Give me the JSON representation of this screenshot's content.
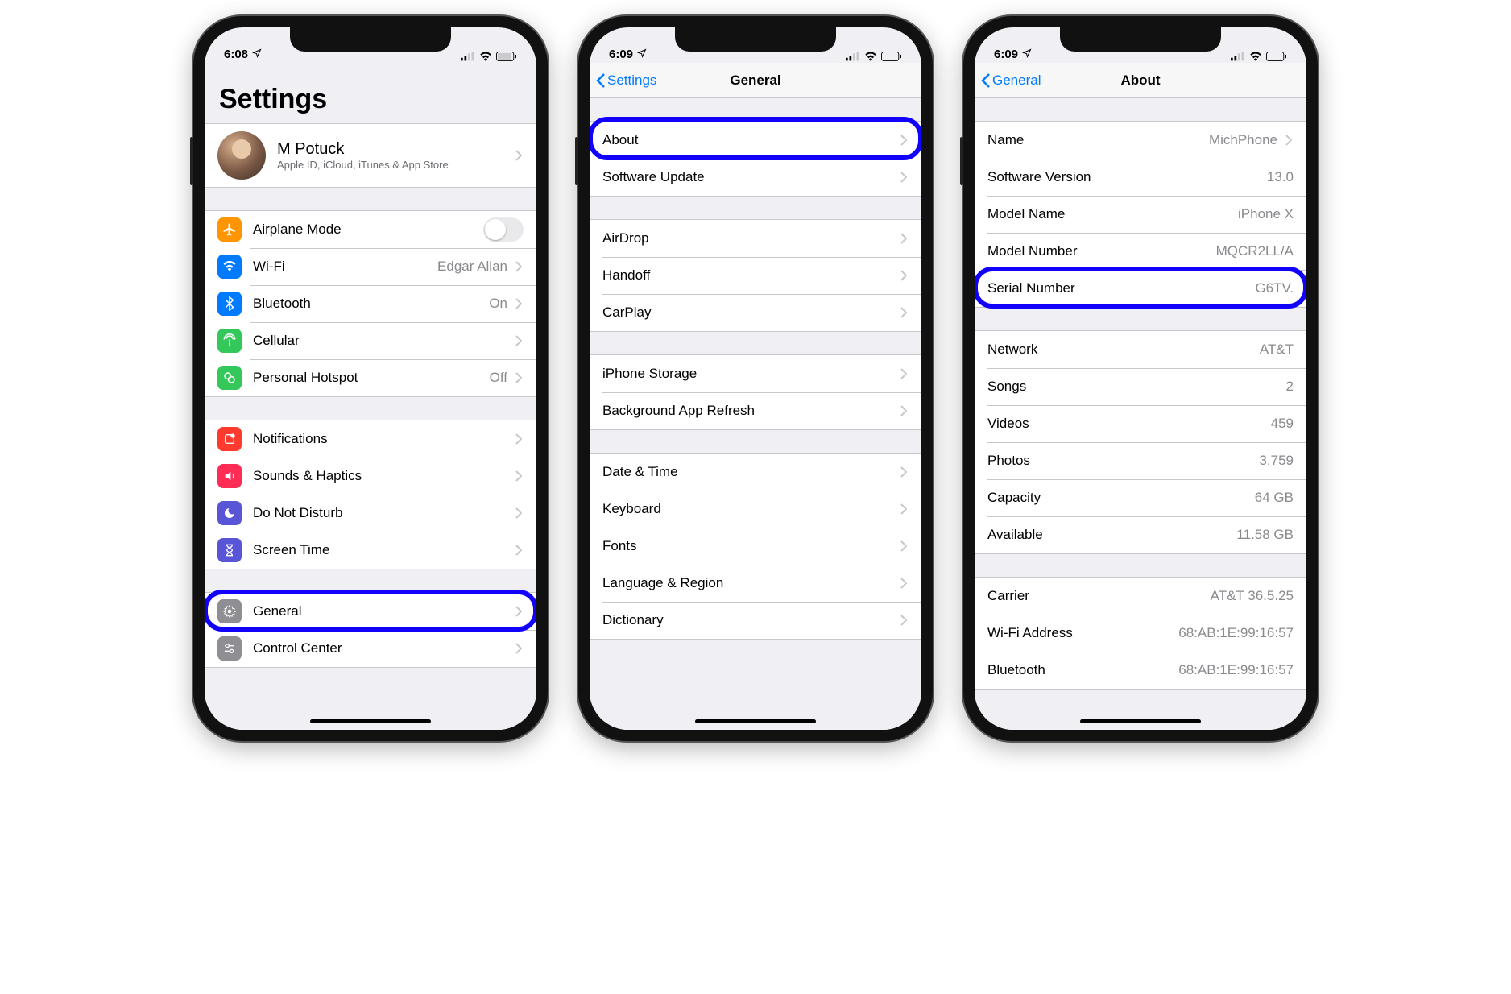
{
  "phone1": {
    "time": "6:08",
    "title": "Settings",
    "profile": {
      "name": "M Potuck",
      "subtitle": "Apple ID, iCloud, iTunes & App Store"
    },
    "group1": [
      {
        "icon": "airplane-icon",
        "label": "Airplane Mode",
        "toggle": true
      },
      {
        "icon": "wifi-icon",
        "label": "Wi-Fi",
        "value": "Edgar Allan"
      },
      {
        "icon": "bluetooth-icon",
        "label": "Bluetooth",
        "value": "On"
      },
      {
        "icon": "cellular-icon",
        "label": "Cellular"
      },
      {
        "icon": "hotspot-icon",
        "label": "Personal Hotspot",
        "value": "Off"
      }
    ],
    "group2": [
      {
        "icon": "notifications-icon",
        "label": "Notifications"
      },
      {
        "icon": "sounds-icon",
        "label": "Sounds & Haptics"
      },
      {
        "icon": "dnd-icon",
        "label": "Do Not Disturb"
      },
      {
        "icon": "screentime-icon",
        "label": "Screen Time"
      }
    ],
    "group3": [
      {
        "icon": "general-icon",
        "label": "General",
        "highlight": true
      },
      {
        "icon": "controlcenter-icon",
        "label": "Control Center"
      }
    ]
  },
  "phone2": {
    "time": "6:09",
    "back": "Settings",
    "title": "General",
    "group1": [
      {
        "label": "About",
        "highlight": true
      },
      {
        "label": "Software Update"
      }
    ],
    "group2": [
      {
        "label": "AirDrop"
      },
      {
        "label": "Handoff"
      },
      {
        "label": "CarPlay"
      }
    ],
    "group3": [
      {
        "label": "iPhone Storage"
      },
      {
        "label": "Background App Refresh"
      }
    ],
    "group4": [
      {
        "label": "Date & Time"
      },
      {
        "label": "Keyboard"
      },
      {
        "label": "Fonts"
      },
      {
        "label": "Language & Region"
      },
      {
        "label": "Dictionary"
      }
    ]
  },
  "phone3": {
    "time": "6:09",
    "back": "General",
    "title": "About",
    "group1": [
      {
        "label": "Name",
        "value": "MichPhone",
        "chevron": true
      },
      {
        "label": "Software Version",
        "value": "13.0"
      },
      {
        "label": "Model Name",
        "value": "iPhone X"
      },
      {
        "label": "Model Number",
        "value": "MQCR2LL/A"
      },
      {
        "label": "Serial Number",
        "value": "G6TV.",
        "highlight": true
      }
    ],
    "group2": [
      {
        "label": "Network",
        "value": "AT&T"
      },
      {
        "label": "Songs",
        "value": "2"
      },
      {
        "label": "Videos",
        "value": "459"
      },
      {
        "label": "Photos",
        "value": "3,759"
      },
      {
        "label": "Capacity",
        "value": "64 GB"
      },
      {
        "label": "Available",
        "value": "11.58 GB"
      }
    ],
    "group3": [
      {
        "label": "Carrier",
        "value": "AT&T 36.5.25"
      },
      {
        "label": "Wi-Fi Address",
        "value": "68:AB:1E:99:16:57"
      },
      {
        "label": "Bluetooth",
        "value": "68:AB:1E:99:16:57"
      }
    ]
  }
}
